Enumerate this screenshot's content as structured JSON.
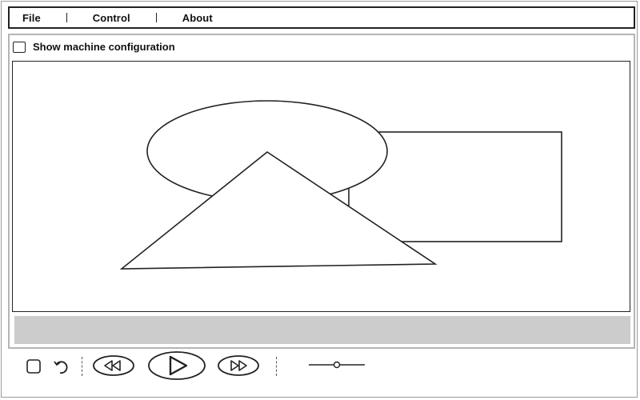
{
  "menu": {
    "items": [
      {
        "label": "File"
      },
      {
        "label": "Control"
      },
      {
        "label": "About"
      }
    ]
  },
  "config": {
    "checkbox_label": "Show machine configuration",
    "checked": false
  },
  "canvas": {
    "shapes": [
      "ellipse",
      "rectangle",
      "triangle"
    ]
  },
  "controls": {
    "icons": [
      "stop-icon",
      "reset-icon",
      "rewind-icon",
      "play-icon",
      "fast-forward-icon",
      "speed-slider"
    ],
    "speed_level": 0.5
  },
  "colors": {
    "stroke": "#222222",
    "status_strip": "#cccccc",
    "panel_border": "#b5b5b5"
  }
}
